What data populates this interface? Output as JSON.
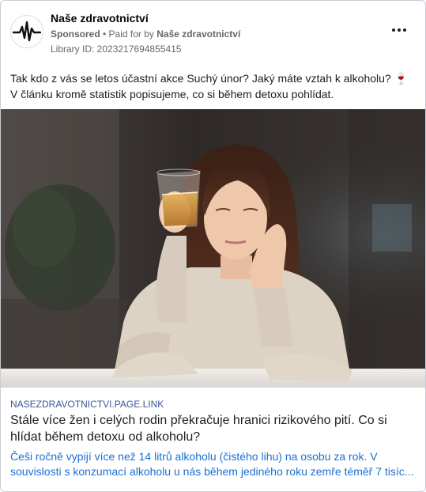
{
  "post": {
    "page_name": "Naše zdravotnictví",
    "sponsored_label": "Sponsored",
    "paid_for_prefix": " • Paid for by ",
    "paid_for_name": "Naše zdravotnictví",
    "library_id": "Library ID: 2023217694855415",
    "body_text": "Tak kdo z vás se letos účastní akce Suchý únor? Jaký máte vztah k alkoholu?",
    "body_text_2": " V článku kromě statistik popisujeme, co si během detoxu pohlídat.",
    "body_icon": "wine-glass-emoji"
  },
  "image": {
    "subject": "photo-woman-with-whiskey-glass",
    "colors": {
      "background_dark": "#3a3533",
      "sweater": "#ddd3c4",
      "hair": "#4a2a1c",
      "table": "#e9e6e2"
    }
  },
  "link": {
    "domain": "NASEZDRAVOTNICTVI.PAGE.LINK",
    "headline": "Stále více žen i celých rodin překračuje hranici rizikového pití. Co si hlídat během detoxu od alkoholu?",
    "description_1": "Češi ročně vypijí více než 14 litrů alkoholu (čistého lihu) na osobu za rok. V",
    "description_2": "souvislosti s konzumací alkoholu u nás během jediného roku zemře téměř 7 tisíc..."
  },
  "icons": {
    "avatar": "heartbeat-pulse-icon",
    "menu": "more-options-icon"
  },
  "accent_colors": {
    "link_blue": "#1b6fd3",
    "domain_blue": "#385898",
    "meta_gray": "#65676b"
  }
}
